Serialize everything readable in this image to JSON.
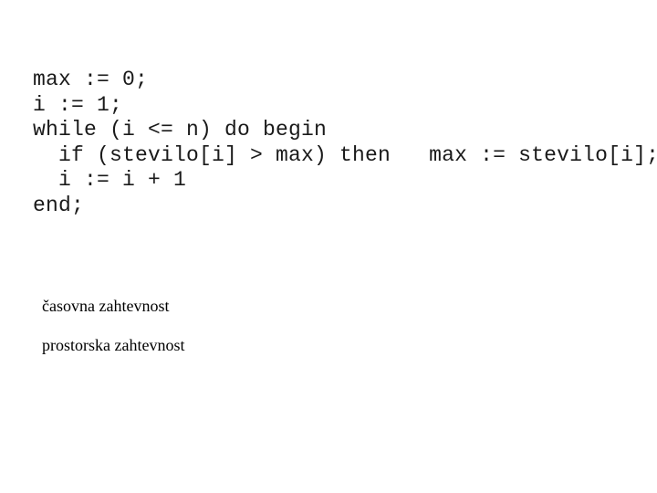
{
  "slide": {
    "background_color": "#ffffff",
    "code": {
      "language_style": "pascal",
      "text_color": "#1a1a1a",
      "lines": [
        "max := 0;",
        "i := 1;",
        "while (i <= n) do begin",
        "  if (stevilo[i] > max) then   max := stevilo[i];",
        "  i := i + 1",
        "end;"
      ]
    },
    "captions": [
      "časovna zahtevnost",
      "prostorska zahtevnost"
    ]
  }
}
